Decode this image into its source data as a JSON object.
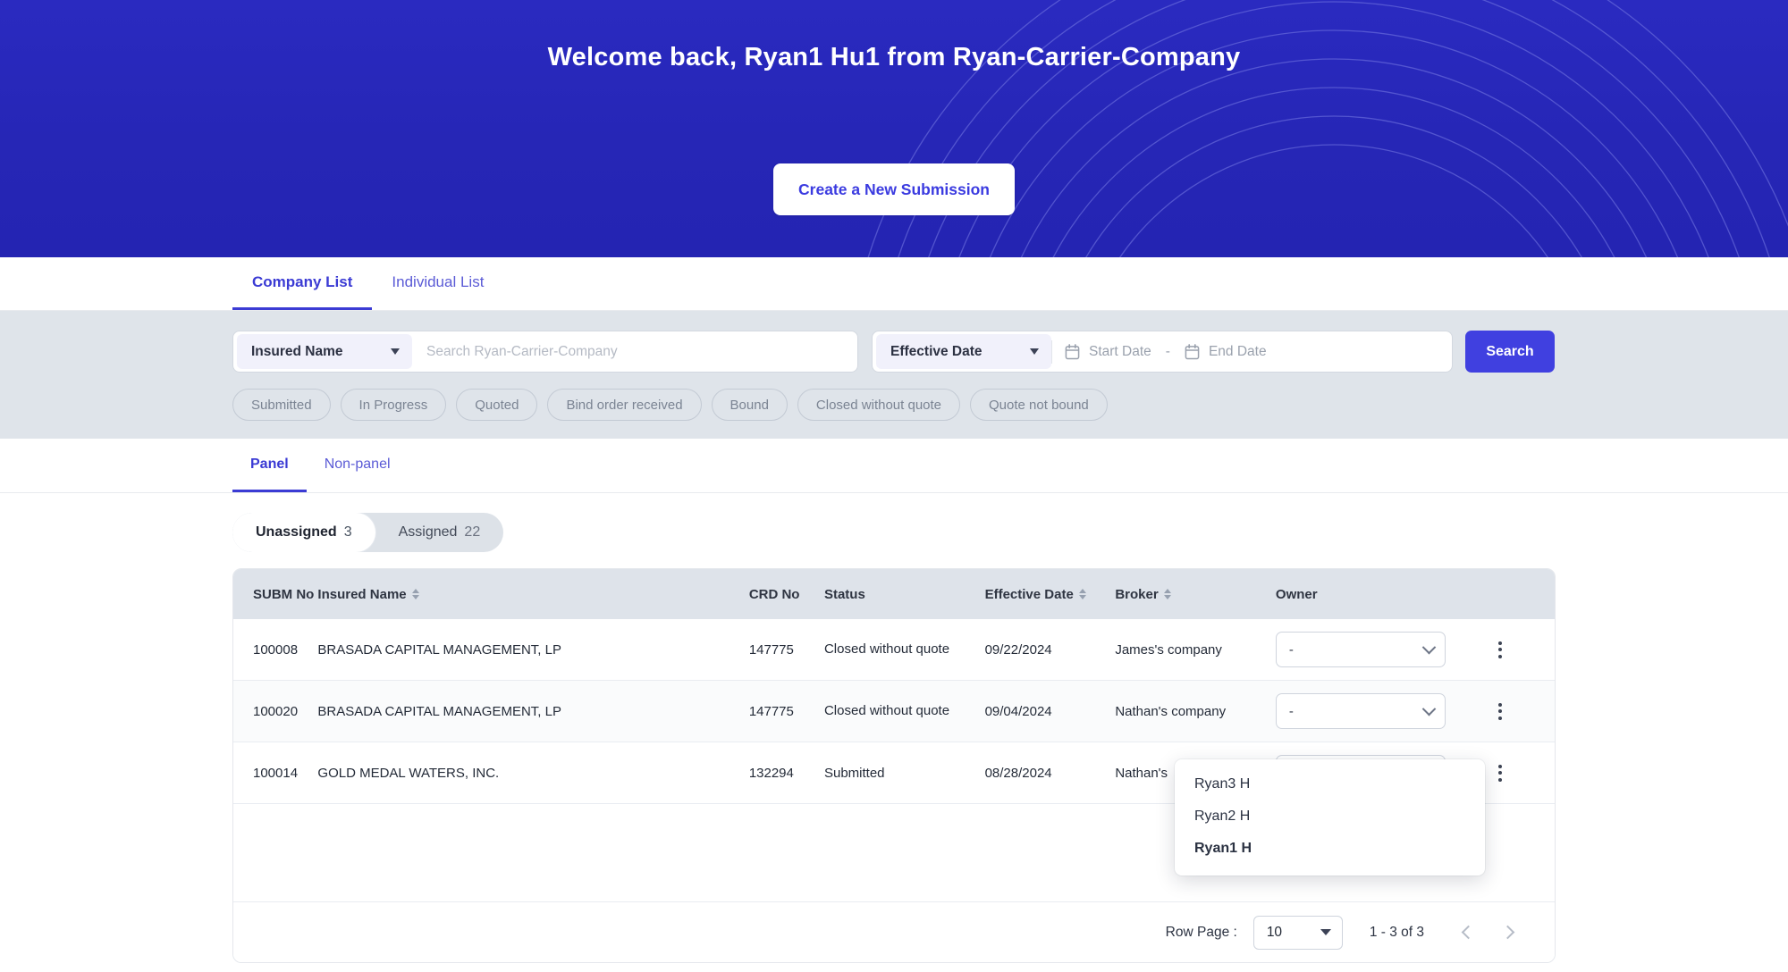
{
  "hero": {
    "title": "Welcome back, Ryan1 Hu1 from Ryan-Carrier-Company",
    "cta_label": "Create a New Submission",
    "bg_color": "#2626b6",
    "cta_text_color": "#3b3be0"
  },
  "list_tabs": [
    {
      "label": "Company List",
      "active": true
    },
    {
      "label": "Individual List",
      "active": false
    }
  ],
  "search": {
    "field_select": "Insured Name",
    "placeholder": "Search Ryan-Carrier-Company",
    "value": "",
    "date_type_select": "Effective Date",
    "start_date_placeholder": "Start Date",
    "start_date_value": "",
    "end_date_placeholder": "End Date",
    "end_date_value": "",
    "date_separator": "-",
    "search_button": "Search",
    "accent_color": "#4040e0"
  },
  "status_chips": [
    "Submitted",
    "In Progress",
    "Quoted",
    "Bind order received",
    "Bound",
    "Closed without quote",
    "Quote not bound"
  ],
  "panel_tabs": [
    {
      "label": "Panel",
      "active": true
    },
    {
      "label": "Non-panel",
      "active": false
    }
  ],
  "assignment_segment": [
    {
      "label": "Unassigned",
      "count": "3",
      "active": true
    },
    {
      "label": "Assigned",
      "count": "22",
      "active": false
    }
  ],
  "table": {
    "columns": [
      {
        "label": "SUBM No",
        "sortable": false
      },
      {
        "label": "Insured Name",
        "sortable": true
      },
      {
        "label": "CRD No",
        "sortable": false
      },
      {
        "label": "Status",
        "sortable": false
      },
      {
        "label": "Effective Date",
        "sortable": true
      },
      {
        "label": "Broker",
        "sortable": true
      },
      {
        "label": "Owner",
        "sortable": false
      },
      {
        "label": "",
        "sortable": false
      }
    ],
    "rows": [
      {
        "subm_no": "100008",
        "insured_name": "BRASADA CAPITAL MANAGEMENT, LP",
        "crd_no": "147775",
        "status": "Closed without quote",
        "effective_date": "09/22/2024",
        "broker": "James's company",
        "owner": "-"
      },
      {
        "subm_no": "100020",
        "insured_name": "BRASADA CAPITAL MANAGEMENT, LP",
        "crd_no": "147775",
        "status": "Closed without quote",
        "effective_date": "09/04/2024",
        "broker": "Nathan's company",
        "owner": "-"
      },
      {
        "subm_no": "100014",
        "insured_name": "GOLD MEDAL WATERS, INC.",
        "crd_no": "132294",
        "status": "Submitted",
        "effective_date": "08/28/2024",
        "broker": "Nathan's",
        "owner": "-"
      }
    ]
  },
  "owner_dropdown": {
    "options": [
      {
        "label": "Ryan3 H",
        "selected": false
      },
      {
        "label": "Ryan2 H",
        "selected": false
      },
      {
        "label": "Ryan1 H",
        "selected": true
      }
    ]
  },
  "pagination": {
    "row_page_label": "Row Page :",
    "rows_per_page": "10",
    "range": "1 - 3  of 3"
  }
}
